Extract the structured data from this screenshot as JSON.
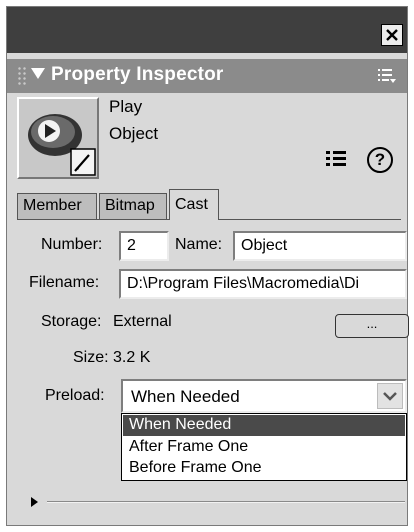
{
  "panel": {
    "title": "Property Inspector",
    "close_glyph": "✕"
  },
  "member": {
    "name": "Play",
    "type": "Object"
  },
  "tabs": [
    {
      "label": "Member",
      "active": false
    },
    {
      "label": "Bitmap",
      "active": false
    },
    {
      "label": "Cast",
      "active": true
    }
  ],
  "fields": {
    "number_label": "Number:",
    "number_value": "2",
    "name_label": "Name:",
    "name_value": "Object",
    "filename_label": "Filename:",
    "filename_value": "D:\\Program Files\\Macromedia\\Di",
    "storage_label": "Storage:",
    "storage_value": "External",
    "browse_label": "...",
    "size_label": "Size:",
    "size_value": "3.2 K",
    "preload_label": "Preload:",
    "preload_value": "When Needed"
  },
  "preload_options": [
    "When Needed",
    "After Frame One",
    "Before Frame One"
  ],
  "icons": {
    "close": "close-icon",
    "options": "panel-options-icon",
    "list": "list-view-icon",
    "help": "help-icon",
    "dropdown": "chevron-down-icon",
    "expand": "expand-arrow-icon"
  },
  "colors": {
    "titlebar": "#3f3f3f",
    "panel_header": "#8b8b8b",
    "panel_bg": "#d9d9d9",
    "selection": "#4a4a4a"
  }
}
